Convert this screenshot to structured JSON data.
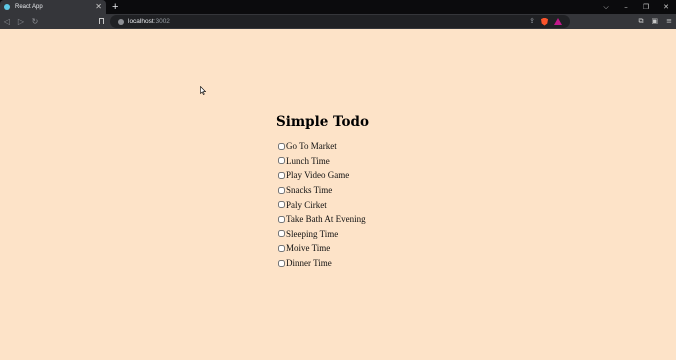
{
  "browser": {
    "tab_title": "React App",
    "tab_close": "✕",
    "new_tab": "+",
    "url_host": "localhost",
    "url_port": ":3002",
    "window_controls": [
      "⌵",
      "–",
      "❐",
      "✕"
    ]
  },
  "app": {
    "title": "Simple Todo",
    "todos": [
      {
        "label": "Go To Market",
        "checked": false
      },
      {
        "label": "Lunch Time",
        "checked": false
      },
      {
        "label": "Play Video Game",
        "checked": false
      },
      {
        "label": "Snacks Time",
        "checked": false
      },
      {
        "label": "Paly Cirket",
        "checked": false
      },
      {
        "label": "Take Bath At Evening",
        "checked": false
      },
      {
        "label": "Sleeping Time",
        "checked": false
      },
      {
        "label": "Moive Time",
        "checked": false
      },
      {
        "label": "Dinner Time",
        "checked": false
      }
    ]
  },
  "colors": {
    "page_background": "#fde3c8",
    "chrome_dark": "#35363a",
    "tabbar_background": "#0b0b0d"
  }
}
